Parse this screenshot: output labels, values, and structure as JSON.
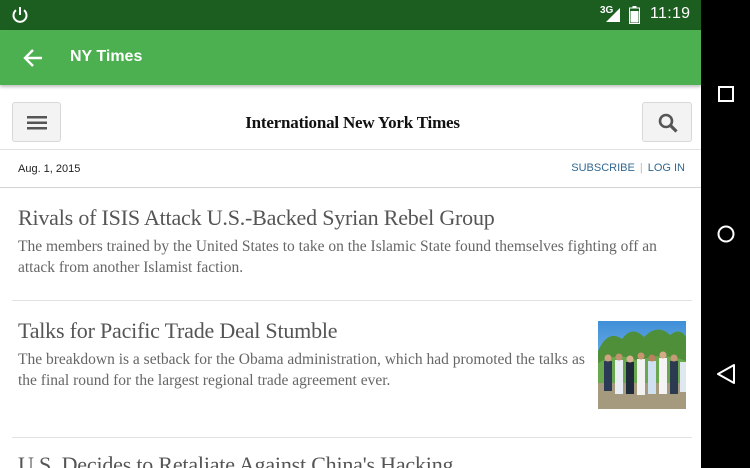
{
  "status_bar": {
    "network": "3G",
    "time": "11:19"
  },
  "app_bar": {
    "title": "NY Times"
  },
  "site": {
    "masthead": "International New York Times",
    "date": "Aug. 1, 2015",
    "subscribe": "SUBSCRIBE",
    "login": "LOG IN"
  },
  "articles": [
    {
      "headline": "Rivals of ISIS Attack U.S.-Backed Syrian Rebel Group",
      "summary": "The members trained by the United States to take on the Islamic State found themselves fighting off an attack from another Islamist faction."
    },
    {
      "headline": "Talks for Pacific Trade Deal Stumble",
      "summary": "The breakdown is a setback for the Obama administration, which had promoted the talks as the final round for the largest regional trade agreement ever."
    },
    {
      "headline": "U.S. Decides to Retaliate Against China's Hacking",
      "summary": ""
    }
  ],
  "colors": {
    "status_bar": "#1b5e20",
    "app_bar": "#4caf50",
    "link": "#326891"
  }
}
